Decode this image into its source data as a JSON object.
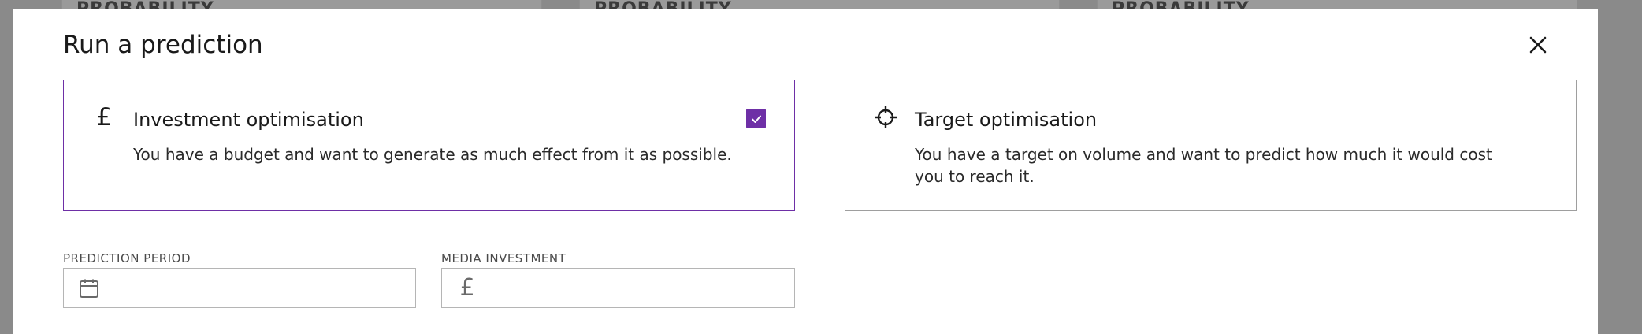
{
  "background": {
    "cards": [
      "PROBABILITY",
      "PROBABILITY",
      "PROBABILITY"
    ]
  },
  "modal": {
    "title": "Run a prediction",
    "close_icon": "close-icon"
  },
  "options": [
    {
      "icon": "pound-icon",
      "icon_glyph": "£",
      "title": "Investment optimisation",
      "description": "You have a budget and want to generate as much effect from it as possible.",
      "selected": true
    },
    {
      "icon": "crosshair-icon",
      "title": "Target optimisation",
      "description": "You have a target on volume and want to predict how much it would cost you to reach it.",
      "selected": false
    }
  ],
  "fields": {
    "prediction_period": {
      "label": "PREDICTION PERIOD",
      "value": "",
      "icon": "calendar-icon"
    },
    "media_investment": {
      "label": "MEDIA INVESTMENT",
      "value": "",
      "icon": "pound-icon",
      "icon_glyph": "£"
    }
  },
  "colors": {
    "accent": "#6e2fa6",
    "border": "#9e9e9e",
    "overlay": "#8a8a8a"
  }
}
